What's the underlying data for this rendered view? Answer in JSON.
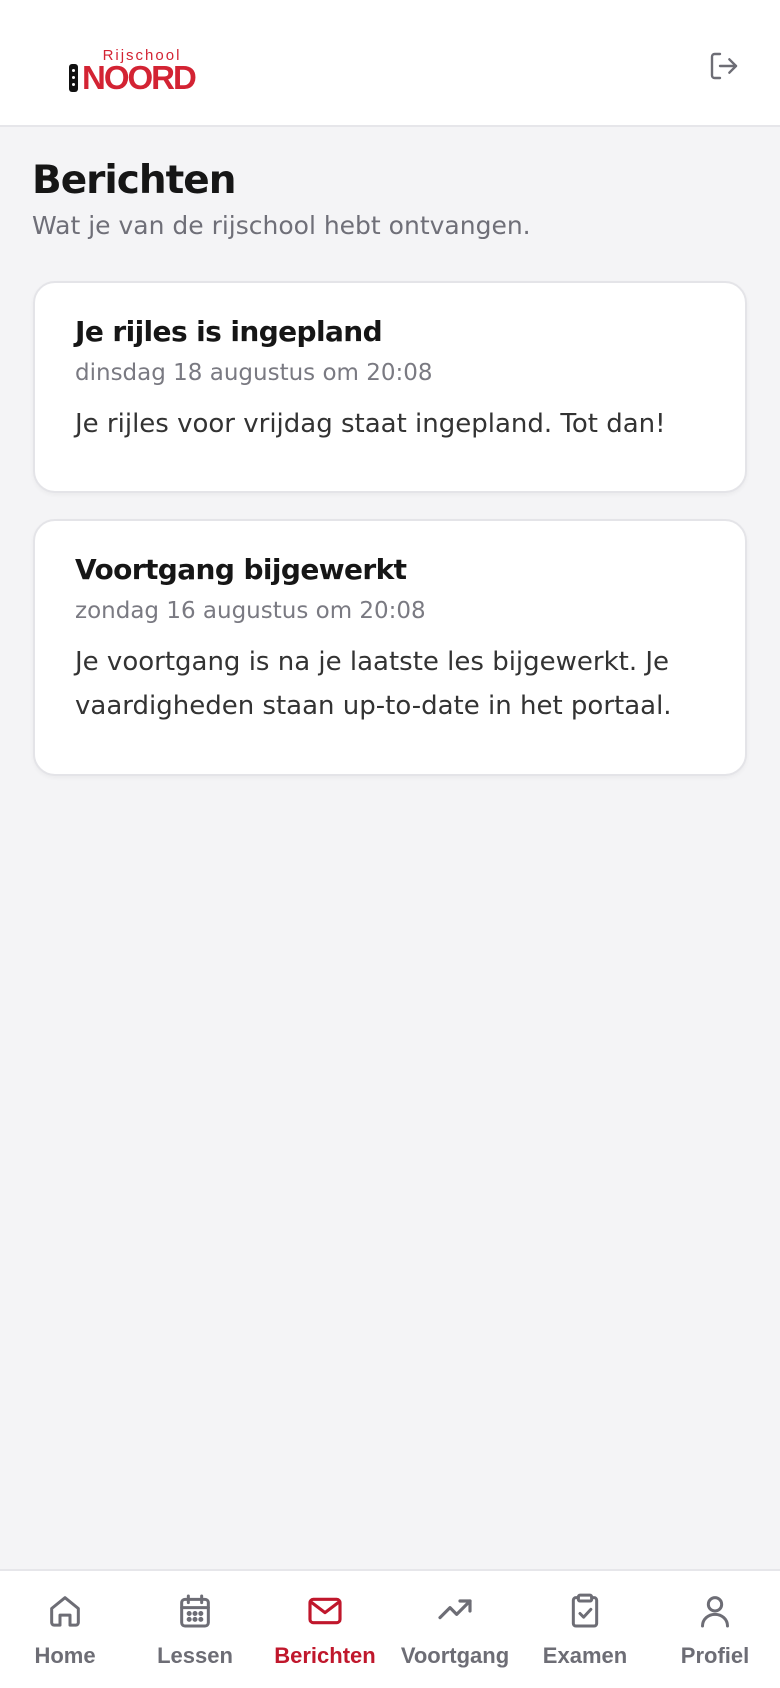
{
  "brand": {
    "top_text": "Rijschool",
    "main_text": "NOORD",
    "accent_color": "#d32333"
  },
  "header": {
    "logout_icon": "logout-icon"
  },
  "page": {
    "title": "Berichten",
    "subtitle": "Wat je van de rijschool hebt ontvangen."
  },
  "messages": [
    {
      "title": "Je rijles is ingepland",
      "date": "dinsdag 18 augustus om 20:08",
      "body": "Je rijles voor vrijdag staat ingepland. Tot dan!"
    },
    {
      "title": "Voortgang bijgewerkt",
      "date": "zondag 16 augustus om 20:08",
      "body": "Je voortgang is na je laatste les bijgewerkt. Je vaardigheden staan up-to-date in het portaal."
    }
  ],
  "nav": {
    "active": "Berichten",
    "active_color": "#c0172c",
    "items": [
      {
        "label": "Home",
        "icon": "home-icon"
      },
      {
        "label": "Lessen",
        "icon": "calendar-icon"
      },
      {
        "label": "Berichten",
        "icon": "mail-icon"
      },
      {
        "label": "Voortgang",
        "icon": "trending-up-icon"
      },
      {
        "label": "Examen",
        "icon": "clipboard-check-icon"
      },
      {
        "label": "Profiel",
        "icon": "user-icon"
      }
    ]
  }
}
